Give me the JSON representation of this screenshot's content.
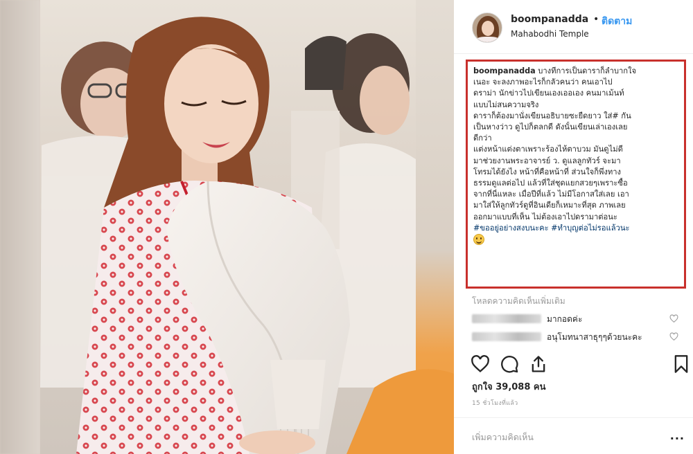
{
  "post": {
    "username": "boompanadda",
    "separator": "•",
    "follow_label": "ติดตาม",
    "location": "Mahabodhi Temple",
    "avatar_icon": "profile-photo"
  },
  "caption": {
    "user": "boompanadda",
    "lines": [
      " บางทีการเป็นดาราก็ลำบากใจ",
      "เนอะ จะลงภาพอะไรก็กลัวคนว่า คนเอาไป",
      "ดราม่า นักข่าวไปเขียนเองเออเอง คนมาเม้นท์",
      "แบบไม่สนความจริง",
      "ดาราก็ต้องมานั่งเขียนอธิบายซะยืดยาว ใส่# กัน",
      "เป็นหางว่าว ดูไปก็ตลกดี ดังนั้นเขียนเล่าเองเลย",
      "ดีกว่า",
      "แต่งหน้าแต่งตาเพราะร้องไห้ตาบวม มันดูไม่ดี",
      "มาช่วยงานพระอาจารย์ ว. ดูแลลูกทัวร์ จะมา",
      "โทรมได้ยังไง หน้าที่คือหน้าที่ ส่วนใจก็พึ่งทาง",
      "ธรรมดูแลต่อไป แล้วที่ใส่ชุดแยกสวยๆเพราะซื้อ",
      "จากที่นี่แหละ เมื่อปีที่แล้ว ไม่มีโอกาสใส่เลย เอา",
      "มาใส่ให้ลูกทัวร์ดูที่อินเดียก็เหมาะที่สุด ภาพเลย",
      "ออกมาแบบที่เห็น ไม่ต้องเอาไปดรามาต่อนะ"
    ],
    "hashtags": "#ขออยู่อย่างสงบนะคะ #ทำบุญต่อไม่รอแล้วนะ",
    "emoji": "smiling-face"
  },
  "comments": {
    "load_more": "โหลดความคิดเห็นเพิ่มเติม",
    "items": [
      {
        "text": "มากอดค่ะ"
      },
      {
        "text": "อนุโมทนาสาธุๆๆด้วยนะคะ"
      }
    ]
  },
  "stats": {
    "likes": "ถูกใจ 39,088 คน",
    "time": "15 ชั่วโมงที่แล้ว"
  },
  "composer": {
    "placeholder": "เพิ่มความคิดเห็น",
    "more": "..."
  },
  "colors": {
    "follow": "#3897f0",
    "highlight_border": "#c8302c",
    "hashtag": "#003569",
    "muted": "#999999"
  }
}
